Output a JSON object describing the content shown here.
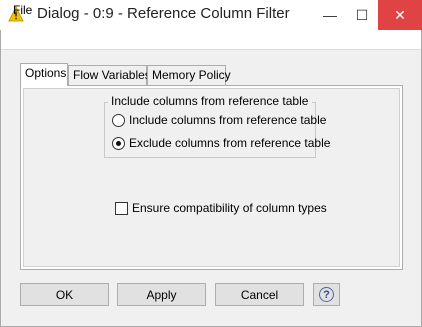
{
  "window": {
    "title": "Dialog - 0:9 - Reference Column Filter",
    "minimize_glyph": "—",
    "maximize_glyph": "☐",
    "close_glyph": "✕",
    "app_icon": "knime-warning-triangle-icon",
    "close_color": "#e04343"
  },
  "menu": {
    "file_label": "File"
  },
  "tabs": [
    {
      "label": "Options",
      "active": true
    },
    {
      "label": "Flow Variables",
      "active": false
    },
    {
      "label": "Memory Policy",
      "active": false
    }
  ],
  "options": {
    "group_title": "Include columns from reference table",
    "radio_include_label": "Include columns from reference table",
    "radio_exclude_label": "Exclude columns from reference table",
    "selected": "exclude",
    "ensure_compat_label": "Ensure compatibility of column types",
    "ensure_compat_checked": false
  },
  "buttons": {
    "ok_label": "OK",
    "apply_label": "Apply",
    "cancel_label": "Cancel",
    "help_glyph": "?"
  }
}
